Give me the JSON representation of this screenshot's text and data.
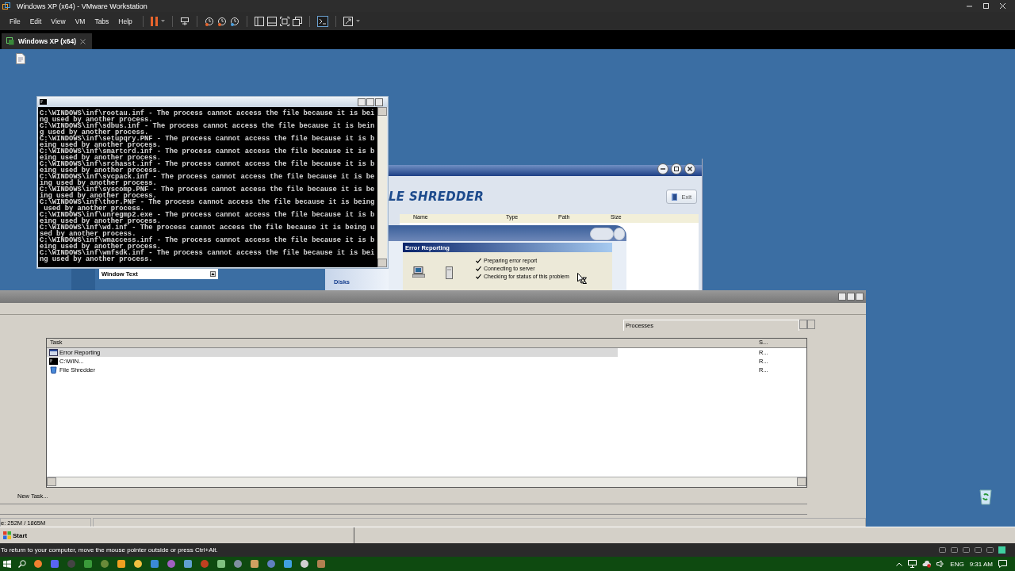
{
  "app": {
    "title": "Windows XP (x64) - VMware Workstation"
  },
  "menus": [
    "File",
    "Edit",
    "View",
    "VM",
    "Tabs",
    "Help"
  ],
  "tabs": [
    {
      "label": "Windows XP (x64)",
      "selected": true
    }
  ],
  "console": {
    "lines": [
      "C:\\WINDOWS\\inf\\rootau.inf - The process cannot access the file because it is bei",
      "ng used by another process.",
      "C:\\WINDOWS\\inf\\sdbus.inf - The process cannot access the file because it is bein",
      "g used by another process.",
      "C:\\WINDOWS\\inf\\setupqry.PNF - The process cannot access the file because it is b",
      "eing used by another process.",
      "C:\\WINDOWS\\inf\\smartcrd.inf - The process cannot access the file because it is b",
      "eing used by another process.",
      "C:\\WINDOWS\\inf\\srchasst.inf - The process cannot access the file because it is b",
      "eing used by another process.",
      "C:\\WINDOWS\\inf\\svcpack.inf - The process cannot access the file because it is be",
      "ing used by another process.",
      "C:\\WINDOWS\\inf\\syscomp.PNF - The process cannot access the file because it is be",
      "ing used by another process.",
      "C:\\WINDOWS\\inf\\thor.PNF - The process cannot access the file because it is being",
      " used by another process.",
      "C:\\WINDOWS\\inf\\unregmp2.exe - The process cannot access the file because it is b",
      "eing used by another process.",
      "C:\\WINDOWS\\inf\\wd.inf - The process cannot access the file because it is being u",
      "sed by another process.",
      "C:\\WINDOWS\\inf\\wmaccess.inf - The process cannot access the file because it is b",
      "eing used by another process.",
      "C:\\WINDOWS\\inf\\wmfsdk.inf - The process cannot access the file because it is bei",
      "ng used by another process."
    ]
  },
  "window_text": "Window Text",
  "disks": "Disks",
  "shredder": {
    "logo": "LE SHREDDER",
    "exit": "Exit",
    "columns": [
      "Name",
      "Type",
      "Path",
      "Size"
    ]
  },
  "error_dialog": {
    "title": "Error Reporting",
    "steps": [
      {
        "label": "Preparing error report",
        "checked": true
      },
      {
        "label": "Connecting to server",
        "checked": true
      },
      {
        "label": "Checking for status of this problem",
        "checked": true
      }
    ]
  },
  "task_manager": {
    "tab": "Processes",
    "columns": [
      "Task",
      "S..."
    ],
    "rows": [
      {
        "kind": "window",
        "task": "Error Reporting",
        "status": "R...",
        "selected": true
      },
      {
        "kind": "console",
        "task": "C:\\WIN...",
        "status": "R...",
        "selected": false
      },
      {
        "kind": "app",
        "task": "File Shredder",
        "status": "R...",
        "selected": false
      }
    ],
    "new_task": "New Task...",
    "memory": "e: 252M / 1865M"
  },
  "start": "Start",
  "vm_hint": "To return to your computer, move the mouse pointer outside or press Ctrl+Alt.",
  "tray": {
    "language": "ENG",
    "time": "9:31 AM"
  }
}
